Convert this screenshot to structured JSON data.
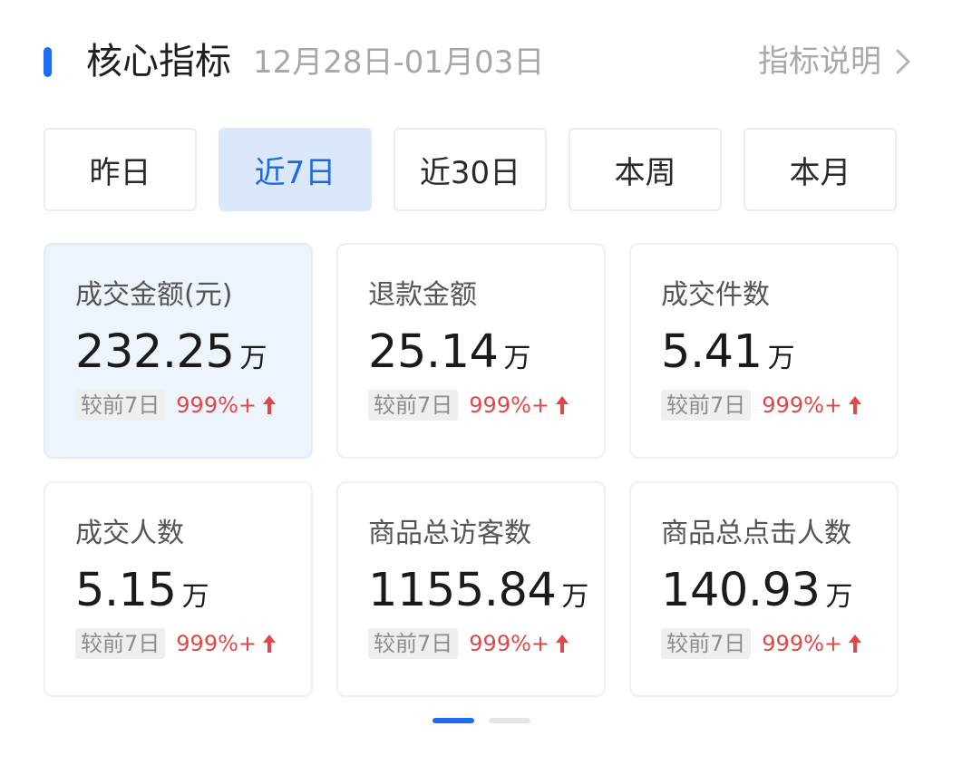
{
  "header": {
    "title": "核心指标",
    "date_range": "12月28日-01月03日",
    "explain_label": "指标说明",
    "accent_color": "#1f6cf3",
    "explain_icon": "chevron-right-icon"
  },
  "tabs": [
    {
      "label": "昨日",
      "active": false
    },
    {
      "label": "近7日",
      "active": true
    },
    {
      "label": "近30日",
      "active": false
    },
    {
      "label": "本周",
      "active": false
    },
    {
      "label": "本月",
      "active": false
    }
  ],
  "metrics": [
    {
      "label": "成交金额(元)",
      "value": "232.25",
      "unit": "万",
      "compare_label": "较前7日",
      "compare_value": "999%+",
      "trend": "up",
      "selected": true
    },
    {
      "label": "退款金额",
      "value": "25.14",
      "unit": "万",
      "compare_label": "较前7日",
      "compare_value": "999%+",
      "trend": "up",
      "selected": false
    },
    {
      "label": "成交件数",
      "value": "5.41",
      "unit": "万",
      "compare_label": "较前7日",
      "compare_value": "999%+",
      "trend": "up",
      "selected": false
    },
    {
      "label": "成交人数",
      "value": "5.15",
      "unit": "万",
      "compare_label": "较前7日",
      "compare_value": "999%+",
      "trend": "up",
      "selected": false
    },
    {
      "label": "商品总访客数",
      "value": "1155.84",
      "unit": "万",
      "compare_label": "较前7日",
      "compare_value": "999%+",
      "trend": "up",
      "selected": false
    },
    {
      "label": "商品总点击人数",
      "value": "140.93",
      "unit": "万",
      "compare_label": "较前7日",
      "compare_value": "999%+",
      "trend": "up",
      "selected": false
    }
  ],
  "pager": {
    "total_pages": 2,
    "current_page": 1
  },
  "colors": {
    "active_tab_bg": "#dbe8fb",
    "active_tab_text": "#1d68e6",
    "selected_card_bg": "#edf4fc",
    "increase_color": "#e04848",
    "muted_text": "#a7a7a7"
  },
  "trend_icon": "arrow-up-icon"
}
